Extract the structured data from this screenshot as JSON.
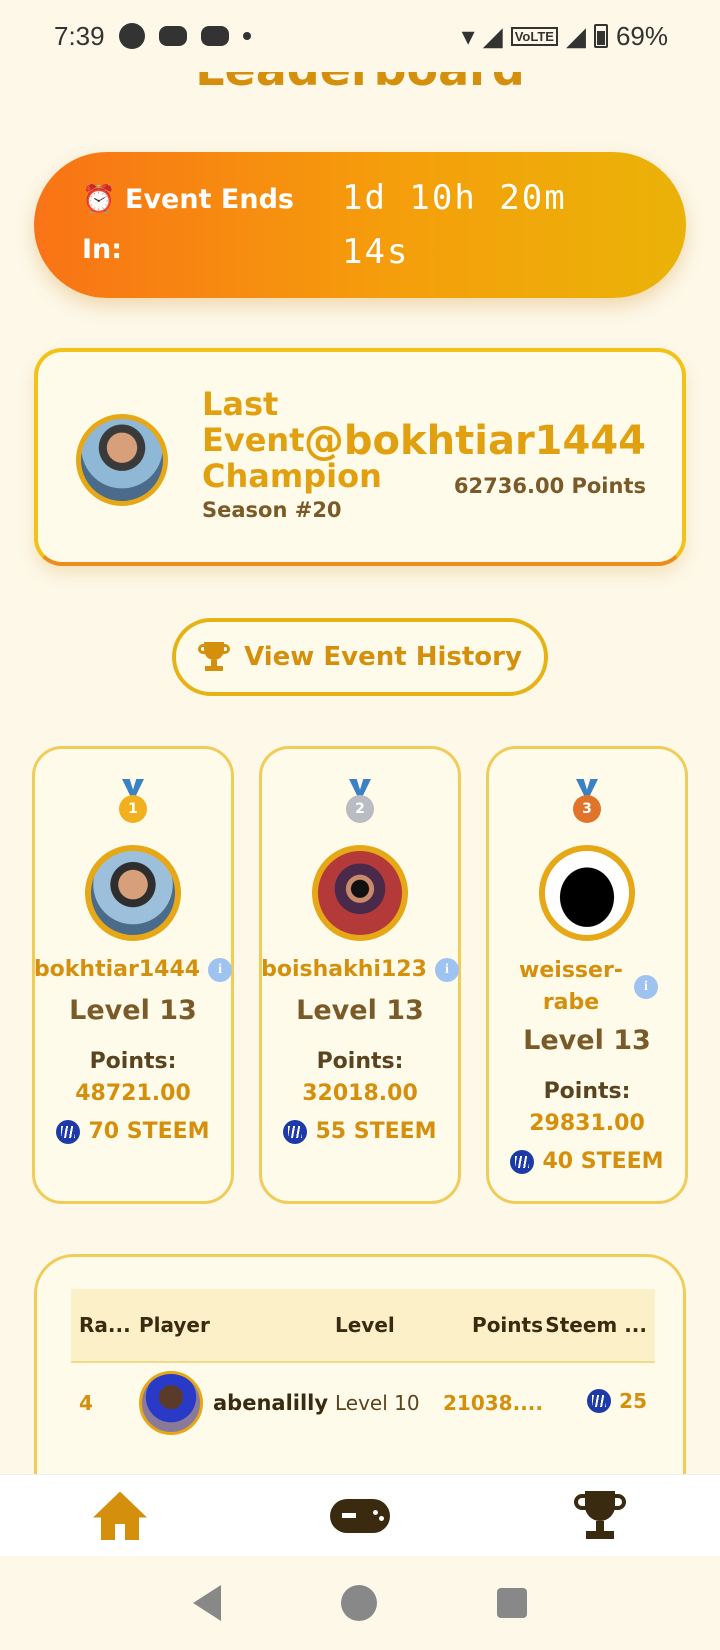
{
  "status_bar": {
    "time": "7:39",
    "network": "VoLTE",
    "battery": "69%"
  },
  "page": {
    "title": "Leaderboard"
  },
  "countdown": {
    "label": "⏰ Event Ends In:",
    "time": "1d 10h 20m 14s"
  },
  "champion": {
    "title": "Last Event Champion",
    "season": "Season #20",
    "username": "@bokhtiar1444",
    "points": "62736.00 Points"
  },
  "history_button": {
    "label": "View Event History",
    "icon": "trophy-icon"
  },
  "podium": [
    {
      "rank": "1",
      "medal": "gold",
      "username": "bokhtiar1444",
      "level": "Level 13",
      "points_label": "Points:",
      "points": "48721.00",
      "steem": "70 STEEM"
    },
    {
      "rank": "2",
      "medal": "silver",
      "username": "boishakhi123",
      "level": "Level 13",
      "points_label": "Points:",
      "points": "32018.00",
      "steem": "55 STEEM"
    },
    {
      "rank": "3",
      "medal": "bronze",
      "username": "weisser-rabe",
      "level": "Level 13",
      "points_label": "Points:",
      "points": "29831.00",
      "steem": "40 STEEM"
    }
  ],
  "table": {
    "headers": {
      "rank": "Ra...",
      "player": "Player",
      "level": "Level",
      "points": "Points",
      "steem": "Steem ..."
    },
    "rows": [
      {
        "rank": "4",
        "player": "abenalilly",
        "level": "Level 10",
        "points": "21038....",
        "steem": "25"
      }
    ]
  },
  "bottom_nav": [
    "home-icon",
    "gamepad-icon",
    "trophy-icon"
  ],
  "colors": {
    "accent": "#d4900c",
    "background": "#fdf8e8",
    "gradient_start": "#f97316",
    "gradient_end": "#eab308"
  }
}
